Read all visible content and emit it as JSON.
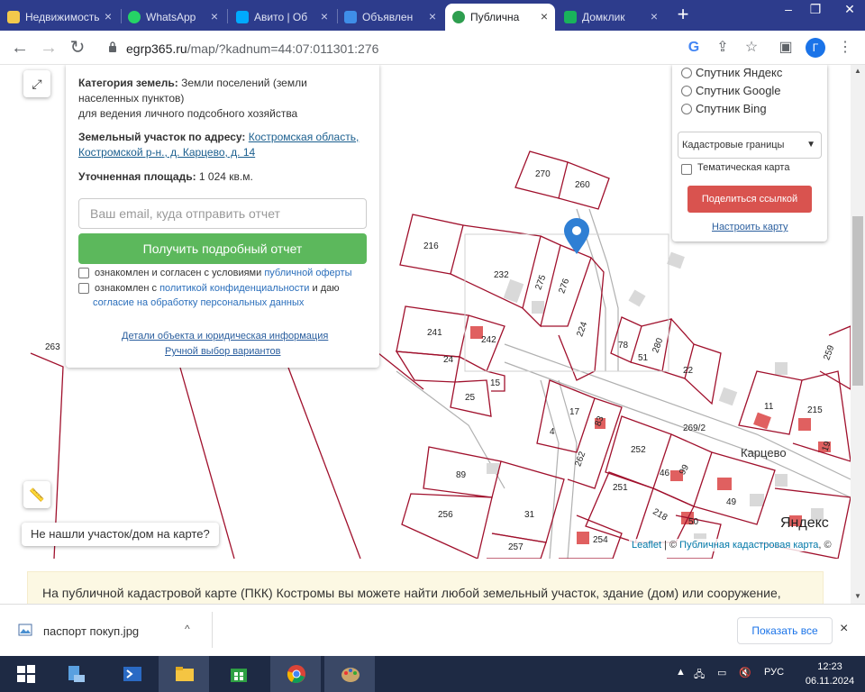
{
  "browser": {
    "tabs": [
      {
        "label": "Недвижимость",
        "fav": "#f2c94c"
      },
      {
        "label": "WhatsApp",
        "fav": "#25d366"
      },
      {
        "label": "Авито | Об",
        "fav": "#00aaff"
      },
      {
        "label": "Объявлен",
        "fav": "#3f8ee8"
      },
      {
        "label": "Публична",
        "fav": "#2e9e4f",
        "active": true
      },
      {
        "label": "Домклик",
        "fav": "#19b35b"
      }
    ],
    "close_glyph": "×",
    "new_tab_glyph": "+",
    "url_host": "egrp365.ru",
    "url_rest": "/map/?kadnum=44:07:011301:276",
    "avatar_letter": "Г"
  },
  "infobox": {
    "cat_label": "Категория земель:",
    "cat_value": " Земли поселений (земли населенных пунктов)",
    "use_value": "для ведения личного подсобного хозяйства",
    "addr_label": "Земельный участок по адресу:",
    "addr_value": "Костромская область, Костромской р-н., д. Карцево, д. 14",
    "area_label": "Уточненная площадь:",
    "area_value": " 1 024 кв.м.",
    "email_placeholder": "Ваш email, куда отправить отчет",
    "get_report": "Получить подробный отчет",
    "consent1_a": "ознакомлен и согласен с условиями ",
    "consent1_link": "публичной оферты",
    "consent2_a": "ознакомлен с ",
    "consent2_link": "политикой конфиденциальности",
    "consent2_b": " и даю",
    "consent2_link2": "согласие на обработку персональных данных",
    "details_link": "Детали объекта и юридическая информация",
    "manual_link": "Ручной выбор вариантов"
  },
  "layers": {
    "options": [
      "Спутник Яндекс",
      "Спутник Google",
      "Спутник Bing"
    ],
    "select_value": "Кадастровые границы",
    "thematic": "Тематическая карта",
    "share": "Поделиться ссылкой",
    "setup": "Настроить карту"
  },
  "map": {
    "not_found": "Не нашли участок/дом на карте?",
    "attrib_leaflet": "Leaflet",
    "attrib_sep": " | © ",
    "attrib_pkk": "Публичная кадастровая карта",
    "attrib_end": ", ©",
    "yandex": "Яндекс",
    "place": "Карцево",
    "plots": [
      "263",
      "270",
      "260",
      "216",
      "232",
      "275",
      "276",
      "241",
      "242",
      "24",
      "25",
      "15",
      "224",
      "78",
      "51",
      "280",
      "22",
      "11",
      "215",
      "259",
      "19",
      "269/2",
      "17",
      "4",
      "83",
      "262",
      "252",
      "46",
      "99",
      "49",
      "89",
      "251",
      "218",
      "50",
      "256",
      "31",
      "257",
      "254"
    ],
    "colors": {
      "plot_line": "#a0102c",
      "road": "#b0b0b0",
      "building": "#d9d9d9",
      "red_building": "#e06060",
      "marker": "#2f7fd4"
    }
  },
  "promo": "На публичной кадастровой карте (ПКК) Костромы вы можете найти любой земельный участок, здание (дом) или сооружение,",
  "download": {
    "filename": "паспорт покуп.jpg",
    "caret": "^",
    "show_all": "Показать все",
    "close": "×"
  },
  "taskbar": {
    "lang": "РУС",
    "time": "12:23",
    "date": "06.11.2024"
  }
}
